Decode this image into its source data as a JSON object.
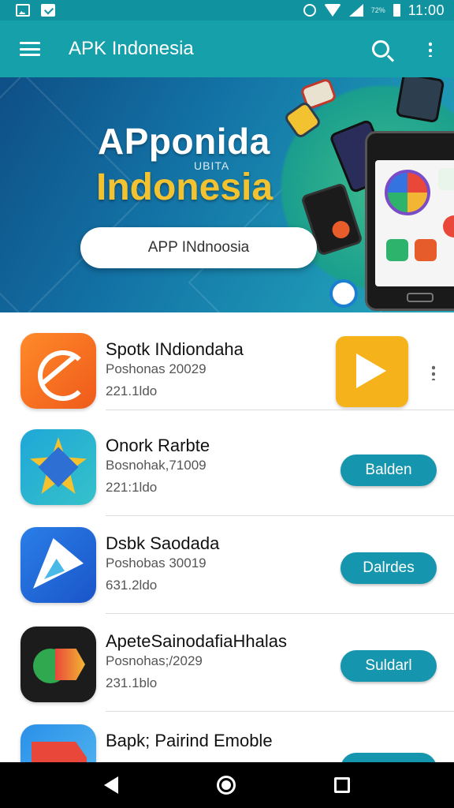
{
  "status_bar": {
    "time": "11:00",
    "signal_text": "72%",
    "icons": [
      "photo-icon",
      "mail-icon",
      "alarm-icon",
      "wifi-icon",
      "signal-icon",
      "battery-icon"
    ]
  },
  "app_bar": {
    "title": "APK Indonesia",
    "icons": [
      "menu-icon",
      "search-icon",
      "more-vert-icon"
    ]
  },
  "banner": {
    "title": "APponida",
    "subtitle": "UBITA",
    "heading": "Indonesia",
    "button_label": "APP INdnoosia"
  },
  "apps": [
    {
      "name": "Spotk INdiondaha",
      "meta": "Poshonas 20029",
      "size": "221.1ldo",
      "action": "",
      "icon": "orange-swirl-icon"
    },
    {
      "name": "Onork Rarbte",
      "meta": "Bosnohak,71009",
      "size": "221:1ldo",
      "action": "Balden",
      "icon": "star-diamond-icon"
    },
    {
      "name": "Dsbk Saodada",
      "meta": "Poshobas 30019",
      "size": "631.2ldo",
      "action": "Dalrdes",
      "icon": "blue-arrow-icon"
    },
    {
      "name": "ApeteSainodafiaHhalas",
      "meta": "Posnohas;/2029",
      "size": "231.1blo",
      "action": "Suldarl",
      "icon": "chat-arrow-icon"
    },
    {
      "name": "Bapk; Pairind Emoble",
      "meta": "",
      "size": "",
      "action": "",
      "icon": "colorful-icon"
    }
  ],
  "colors": {
    "status_bar": "#10939e",
    "app_bar": "#16a0aa",
    "action_button": "#1595ae",
    "banner_heading": "#f2c230"
  },
  "nav": [
    "back-icon",
    "home-icon",
    "recents-icon"
  ]
}
